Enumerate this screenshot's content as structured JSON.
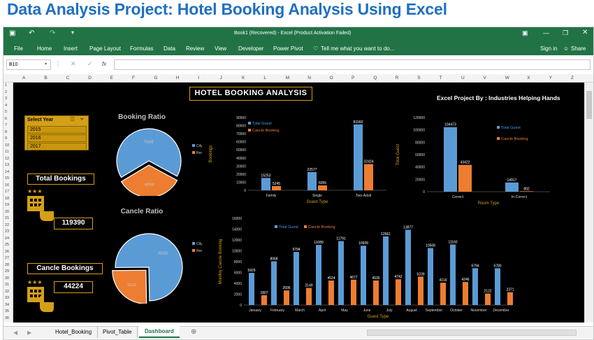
{
  "heading": "Data Analysis Project: Hotel Booking Analysis Using Excel",
  "window": {
    "title": "Book1 (Recovered) - Excel (Product Activation Failed)",
    "signin": "Sign in",
    "share": "Share"
  },
  "ribbon": {
    "tabs": [
      "File",
      "Home",
      "Insert",
      "Page Layout",
      "Formulas",
      "Data",
      "Review",
      "View",
      "Developer",
      "Power Pivot"
    ],
    "tellme": "Tell me what you want to do..."
  },
  "formula_bar": {
    "name_box": "B10",
    "fx": "fx",
    "value": ""
  },
  "columns": [
    "A",
    "B",
    "C",
    "D",
    "E",
    "F",
    "G",
    "H",
    "I",
    "J",
    "K",
    "L",
    "M",
    "N",
    "O",
    "P",
    "Q",
    "R",
    "S",
    "T",
    "U",
    "V",
    "W",
    "X",
    "Y",
    "Z"
  ],
  "rows": [
    "1",
    "2",
    "3",
    "4",
    "5",
    "6",
    "7",
    "8",
    "9",
    "10",
    "11",
    "12",
    "13",
    "14",
    "15",
    "16",
    "17",
    "18",
    "19",
    "20",
    "21",
    "22",
    "23",
    "24",
    "25",
    "26",
    "27",
    "28",
    "29",
    "30",
    "31",
    "32",
    "33",
    "34",
    "35",
    "36"
  ],
  "dashboard": {
    "title": "HOTEL BOOKING ANALYSIS",
    "credit": "Excel Project By : Industries Helping Hands",
    "slicer": {
      "title": "Select Year",
      "items": [
        "2015",
        "2016",
        "2017"
      ]
    },
    "total_bookings": {
      "label": "Total Bookings",
      "value": "119390"
    },
    "cancel_bookings": {
      "label": "Cancle Bookings",
      "value": "44224"
    }
  },
  "colors": {
    "blue": "#5b9bd5",
    "orange": "#ed7d31",
    "gold": "#d4a017",
    "excel_green": "#217346"
  },
  "sheet_tabs": [
    "Hotel_Booking",
    "Pivot_Table",
    "Dashboard"
  ],
  "active_sheet": "Dashboard",
  "chart_data": [
    {
      "type": "pie",
      "title": "Booking Ratio",
      "categories": [
        "City Hotel",
        "Resort Hotel"
      ],
      "values": [
        79330,
        40060
      ]
    },
    {
      "type": "pie",
      "title": "Cancle Ratio",
      "categories": [
        "City Hotel",
        "Resort Hotel"
      ],
      "values": [
        33102,
        11122
      ]
    },
    {
      "type": "bar",
      "xlabel": "Guest Type",
      "ylabel": "Bookings",
      "ylim": [
        0,
        90000
      ],
      "yticks": [
        "0",
        "10000",
        "20000",
        "30000",
        "40000",
        "50000",
        "60000",
        "70000",
        "80000",
        "90000"
      ],
      "categories": [
        "Family",
        "Single",
        "Two-Adult"
      ],
      "series": [
        {
          "name": "Total Guest",
          "values": [
            15253,
            22577,
            81560
          ]
        },
        {
          "name": "Cancle Booking",
          "values": [
            5245,
            6055,
            32424
          ]
        }
      ]
    },
    {
      "type": "bar",
      "xlabel": "Room Type",
      "ylabel": "Total Guest",
      "ylim": [
        0,
        120000
      ],
      "yticks": [
        "0",
        "20000",
        "40000",
        "60000",
        "80000",
        "100000",
        "120000"
      ],
      "categories": [
        "Correct",
        "In-Correct"
      ],
      "series": [
        {
          "name": "Total Guest",
          "values": [
            104473,
            14917
          ]
        },
        {
          "name": "Cancle Booking",
          "values": [
            43422,
            802
          ]
        }
      ]
    },
    {
      "type": "bar",
      "xlabel": "Guest Type",
      "ylabel": "Monthly Cancle Booking",
      "ylim": [
        0,
        16000
      ],
      "yticks": [
        "0",
        "2000",
        "4000",
        "6000",
        "8000",
        "10000",
        "12000",
        "14000",
        "16000"
      ],
      "categories": [
        "January",
        "February",
        "March",
        "April",
        "May",
        "June",
        "July",
        "August",
        "September",
        "October",
        "November",
        "December"
      ],
      "series": [
        {
          "name": "Total Guest",
          "values": [
            5929,
            8068,
            9794,
            11089,
            11791,
            10939,
            12661,
            13877,
            10508,
            11160,
            6794,
            6780
          ]
        },
        {
          "name": "Cancle Booking",
          "values": [
            1807,
            2696,
            3149,
            4524,
            4677,
            4535,
            4742,
            5239,
            4116,
            4246,
            2122,
            2371
          ]
        }
      ]
    }
  ]
}
